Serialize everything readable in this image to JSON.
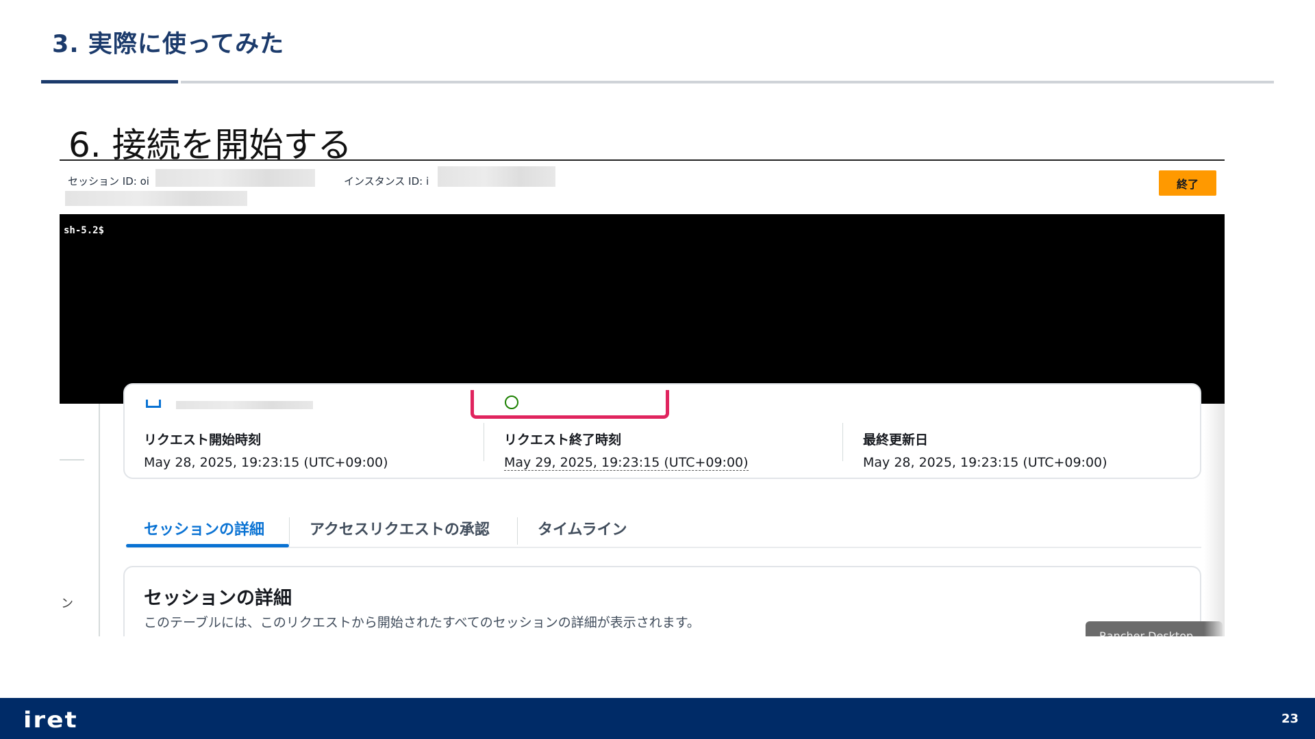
{
  "slide": {
    "section_title": "3. 実際に使ってみた",
    "step_title": "6. 接続を開始する",
    "page_number": "23",
    "logo_text": "iret"
  },
  "session_header": {
    "session_id_label": "セッション ID: oi",
    "instance_id_label": "インスタンス ID: i",
    "end_button_label": "終了"
  },
  "terminal": {
    "prompt": "sh-5.2$"
  },
  "request_summary": {
    "fields": [
      {
        "label": "リクエスト開始時刻",
        "value": "May 28, 2025, 19:23:15 (UTC+09:00)"
      },
      {
        "label": "リクエスト終了時刻",
        "value": "May 29, 2025, 19:23:15 (UTC+09:00)"
      },
      {
        "label": "最終更新日",
        "value": "May 28, 2025, 19:23:15 (UTC+09:00)"
      }
    ]
  },
  "tabs": [
    {
      "label": "セッションの詳細",
      "active": true
    },
    {
      "label": "アクセスリクエストの承認",
      "active": false
    },
    {
      "label": "タイムライン",
      "active": false
    }
  ],
  "session_details": {
    "title": "セッションの詳細",
    "description": "このテーブルには、このリクエストから開始されたすべてのセッションの詳細が表示されます。"
  },
  "sidebar_fragment": "ン",
  "overlay_app_label": "Rancher Desktop",
  "colors": {
    "brand_navy": "#1b3a6b",
    "footer_navy": "#002b67",
    "aws_orange": "#ff9900",
    "link_blue": "#0972d3",
    "highlight_red": "#e0245e"
  }
}
